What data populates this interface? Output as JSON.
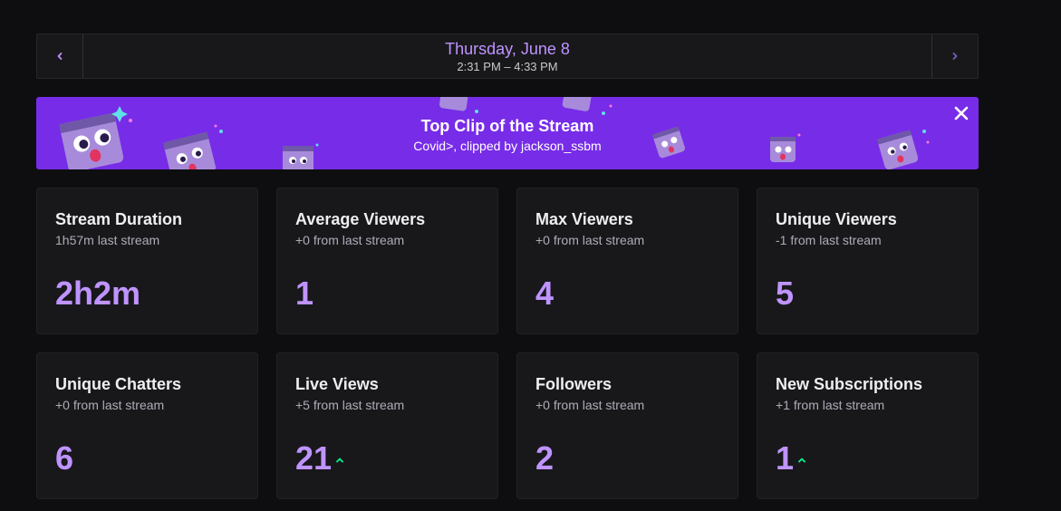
{
  "date_nav": {
    "title": "Thursday, June 8",
    "time_range": "2:31 PM – 4:33 PM",
    "prev_icon": "chevron-left-icon",
    "next_icon": "chevron-right-icon"
  },
  "clip_banner": {
    "title": "Top Clip of the Stream",
    "subtitle": "Covid>, clipped by jackson_ssbm",
    "close_icon": "close-icon",
    "background": "#772ce8"
  },
  "stats": [
    {
      "title": "Stream Duration",
      "sub": "1h57m last stream",
      "value": "2h2m",
      "trend": ""
    },
    {
      "title": "Average Viewers",
      "sub": "+0 from last stream",
      "value": "1",
      "trend": ""
    },
    {
      "title": "Max Viewers",
      "sub": "+0 from last stream",
      "value": "4",
      "trend": ""
    },
    {
      "title": "Unique Viewers",
      "sub": "-1 from last stream",
      "value": "5",
      "trend": ""
    },
    {
      "title": "Unique Chatters",
      "sub": "+0 from last stream",
      "value": "6",
      "trend": ""
    },
    {
      "title": "Live Views",
      "sub": "+5 from last stream",
      "value": "21",
      "trend": "up"
    },
    {
      "title": "Followers",
      "sub": "+0 from last stream",
      "value": "2",
      "trend": ""
    },
    {
      "title": "New Subscriptions",
      "sub": "+1 from last stream",
      "value": "1",
      "trend": "up"
    }
  ],
  "colors": {
    "accent": "#bf94ff",
    "trend_up": "#00f593",
    "card_bg": "#18181b",
    "page_bg": "#0e0e10"
  }
}
